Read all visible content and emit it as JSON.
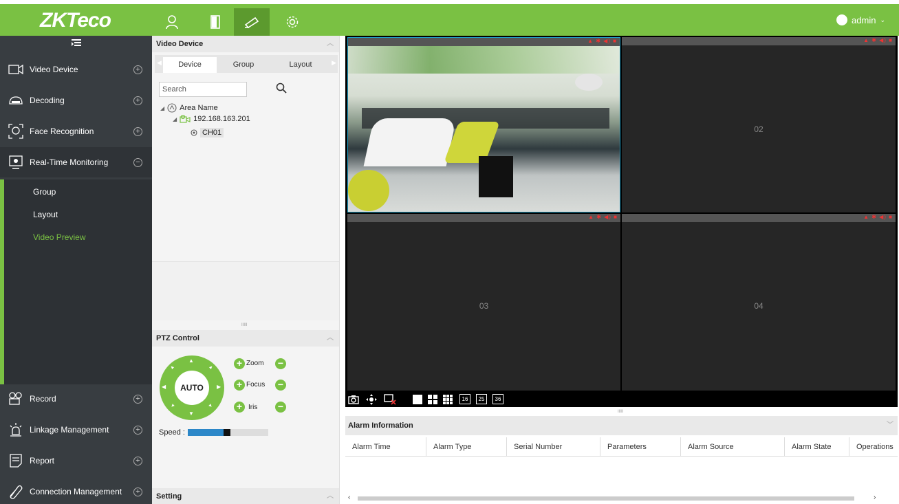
{
  "app": {
    "logo": "ZKTeco",
    "user": "admin",
    "colors": {
      "brand": "#7ac143",
      "sidebar": "#383d41",
      "active_sub": "#7ac143",
      "selected_pane": "#1ea0c8"
    },
    "top_icons": [
      "personnel-icon",
      "door-icon",
      "camera-icon",
      "settings-icon"
    ],
    "active_top_icon": "camera-icon"
  },
  "sidebar": {
    "items": [
      {
        "label": "Video Device",
        "icon": "video-camera-icon",
        "state": "+"
      },
      {
        "label": "Decoding",
        "icon": "decoder-icon",
        "state": "+"
      },
      {
        "label": "Face Recognition",
        "icon": "face-icon",
        "state": "+"
      },
      {
        "label": "Real-Time Monitoring",
        "icon": "monitor-icon",
        "state": "−"
      },
      {
        "label": "Record",
        "icon": "record-icon",
        "state": "+"
      },
      {
        "label": "Linkage Management",
        "icon": "alarm-light-icon",
        "state": "+"
      },
      {
        "label": "Report",
        "icon": "report-icon",
        "state": "+"
      },
      {
        "label": "Connection Management",
        "icon": "link-icon",
        "state": "+"
      }
    ],
    "sub_items": [
      {
        "label": "Group"
      },
      {
        "label": "Layout"
      },
      {
        "label": "Video Preview"
      }
    ],
    "active_sub": "Video Preview"
  },
  "device_panel": {
    "title": "Video Device",
    "tabs": [
      "Device",
      "Group",
      "Layout"
    ],
    "active_tab": "Device",
    "search_placeholder": "Search",
    "tree": {
      "area": "Area Name",
      "device": "192.168.163.201",
      "channel": "CH01"
    }
  },
  "ptz": {
    "title": "PTZ Control",
    "auto_label": "AUTO",
    "zoom_label": "Zoom",
    "focus_label": "Focus",
    "iris_label": "Iris",
    "speed_label": "Speed :"
  },
  "setting": {
    "title": "Setting"
  },
  "video": {
    "panes": [
      {
        "id": "01",
        "number": "",
        "has_feed": true
      },
      {
        "id": "02",
        "number": "02",
        "has_feed": false
      },
      {
        "id": "03",
        "number": "03",
        "has_feed": false
      },
      {
        "id": "04",
        "number": "04",
        "has_feed": false
      }
    ],
    "status_icons": "▲ ✱ ◀) ■",
    "layout_buttons": [
      "16",
      "25",
      "36"
    ]
  },
  "alarm": {
    "title": "Alarm Information",
    "columns": [
      "Alarm Time",
      "Alarm Type",
      "Serial Number",
      "Parameters",
      "Alarm Source",
      "Alarm State",
      "Operations"
    ]
  }
}
